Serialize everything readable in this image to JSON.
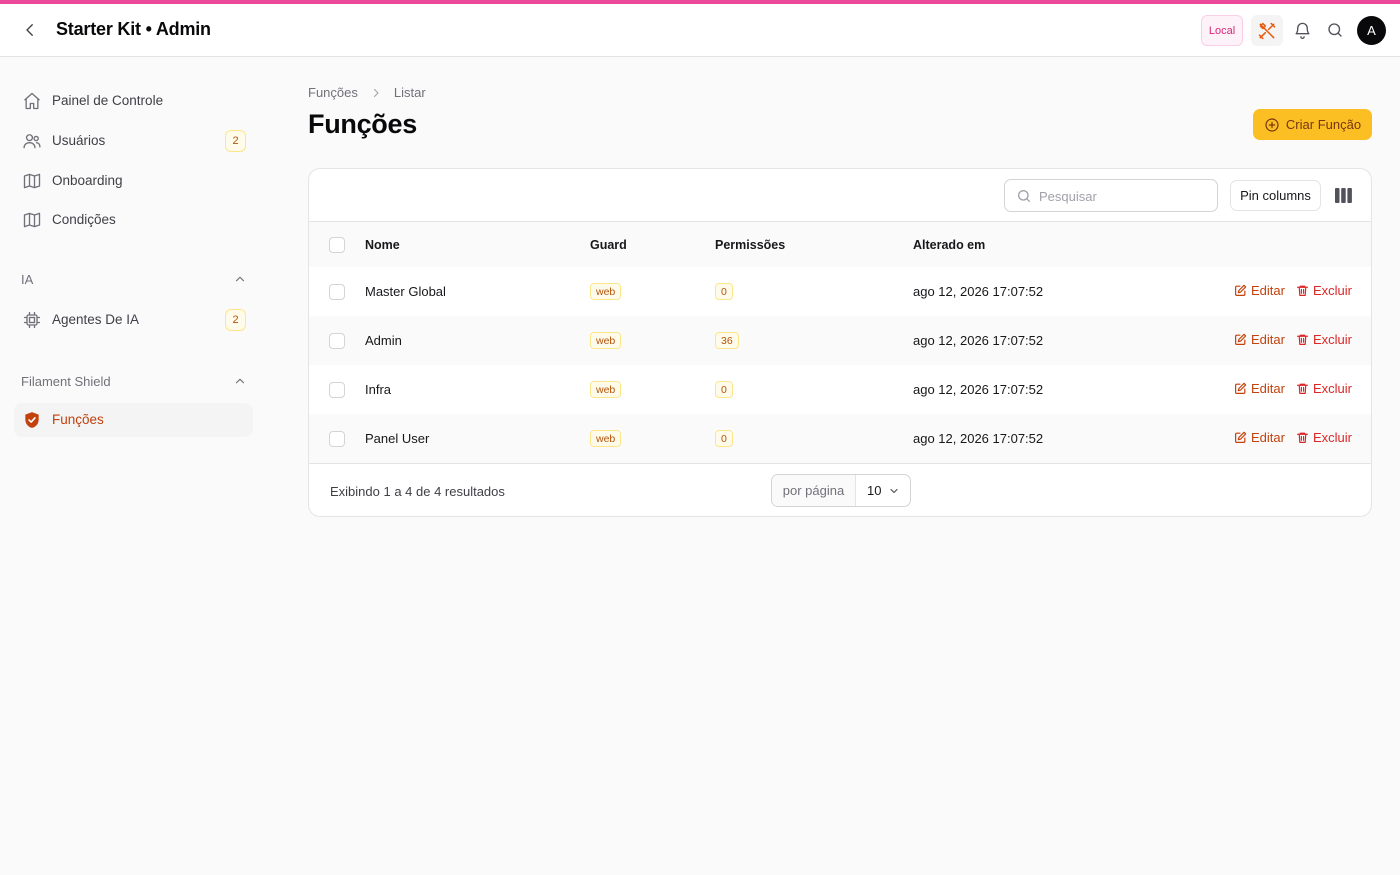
{
  "app": {
    "title": "Starter Kit • Admin",
    "env_badge": "Local",
    "avatar_initial": "A",
    "accent": "#ec4899",
    "primary": "#fbbf24"
  },
  "sidebar": {
    "items": [
      {
        "label": "Painel de Controle",
        "icon": "home-icon"
      },
      {
        "label": "Usuários",
        "icon": "users-icon",
        "badge": "2"
      },
      {
        "label": "Onboarding",
        "icon": "map-icon"
      },
      {
        "label": "Condições",
        "icon": "map-icon"
      }
    ],
    "groups": [
      {
        "label": "IA",
        "items": [
          {
            "label": "Agentes De IA",
            "icon": "cpu-chip-icon",
            "badge": "2"
          }
        ]
      },
      {
        "label": "Filament Shield",
        "items": [
          {
            "label": "Funções",
            "icon": "shield-check-icon",
            "active": true
          }
        ]
      }
    ]
  },
  "breadcrumb": [
    "Funções",
    "Listar"
  ],
  "page": {
    "title": "Funções",
    "create_label": "Criar Função"
  },
  "table": {
    "search_placeholder": "Pesquisar",
    "pin_label": "Pin columns",
    "columns": [
      "Nome",
      "Guard",
      "Permissões",
      "Alterado em"
    ],
    "rows": [
      {
        "name": "Master Global",
        "guard": "web",
        "perms": "0",
        "updated": "ago 12, 2026 17:07:52"
      },
      {
        "name": "Admin",
        "guard": "web",
        "perms": "36",
        "updated": "ago 12, 2026 17:07:52"
      },
      {
        "name": "Infra",
        "guard": "web",
        "perms": "0",
        "updated": "ago 12, 2026 17:07:52"
      },
      {
        "name": "Panel User",
        "guard": "web",
        "perms": "0",
        "updated": "ago 12, 2026 17:07:52"
      }
    ],
    "actions": {
      "edit": "Editar",
      "delete": "Excluir"
    },
    "summary": "Exibindo 1 a 4 de 4 resultados",
    "per_page_label": "por página",
    "per_page_value": "10"
  }
}
